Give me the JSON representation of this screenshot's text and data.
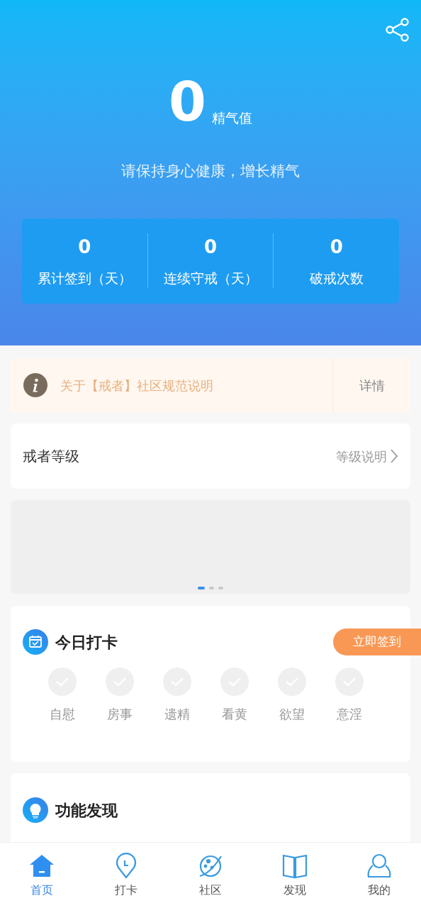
{
  "header": {
    "score": "0",
    "score_unit": "精气值",
    "motto": "请保持身心健康，增长精气",
    "stats": [
      {
        "value": "0",
        "label": "累计签到（天）"
      },
      {
        "value": "0",
        "label": "连续守戒（天）"
      },
      {
        "value": "0",
        "label": "破戒次数"
      }
    ]
  },
  "notice": {
    "text": "关于【戒者】社区规范说明",
    "action": "详情"
  },
  "level": {
    "title": "戒者等级",
    "link": "等级说明"
  },
  "banner": {
    "dots": [
      {
        "selected": true
      },
      {
        "selected": false
      },
      {
        "selected": false
      }
    ]
  },
  "checkin": {
    "title": "今日打卡",
    "button": "立即签到",
    "items": [
      {
        "label": "自慰",
        "checked": false
      },
      {
        "label": "房事",
        "checked": false
      },
      {
        "label": "遗精",
        "checked": false
      },
      {
        "label": "看黄",
        "checked": false
      },
      {
        "label": "欲望",
        "checked": false
      },
      {
        "label": "意淫",
        "checked": false
      }
    ]
  },
  "features": {
    "title": "功能发现"
  },
  "tabs": [
    {
      "label": "首页",
      "kind": "home",
      "selected": true
    },
    {
      "label": "打卡",
      "kind": "pin",
      "selected": false
    },
    {
      "label": "社区",
      "kind": "planet",
      "selected": false
    },
    {
      "label": "发现",
      "kind": "book",
      "selected": false
    },
    {
      "label": "我的",
      "kind": "person",
      "selected": false
    }
  ]
}
